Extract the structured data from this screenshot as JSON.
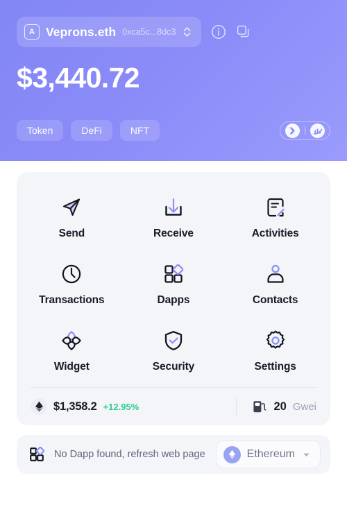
{
  "header": {
    "avatar_letter": "A",
    "account_name": "Veprons.eth",
    "account_address": "0xca5c...8dc3",
    "balance": "$3,440.72",
    "tabs": [
      {
        "label": "Token"
      },
      {
        "label": "DeFi"
      },
      {
        "label": "NFT"
      }
    ],
    "brand_icons": [
      "bitkeep-logo-icon",
      "market-chart-logo-icon"
    ],
    "icons": {
      "avatar": "avatar-letter-icon",
      "switch_account": "chevron-up-down-icon",
      "info": "info-circle-icon",
      "copy": "copy-icon"
    },
    "colors": {
      "gradient_start": "#8286f5",
      "gradient_end": "#9a9bfc",
      "text": "#ffffff"
    }
  },
  "menu": {
    "items": [
      {
        "label": "Send",
        "icon": "send-paper-plane-icon"
      },
      {
        "label": "Receive",
        "icon": "receive-download-icon"
      },
      {
        "label": "Activities",
        "icon": "activities-document-edit-icon"
      },
      {
        "label": "Transactions",
        "icon": "transactions-clock-icon"
      },
      {
        "label": "Dapps",
        "icon": "dapps-grid-icon"
      },
      {
        "label": "Contacts",
        "icon": "contacts-person-icon"
      },
      {
        "label": "Widget",
        "icon": "widget-clover-icon"
      },
      {
        "label": "Security",
        "icon": "security-shield-check-icon"
      },
      {
        "label": "Settings",
        "icon": "settings-gear-icon"
      }
    ]
  },
  "stats": {
    "eth_icon": "ethereum-diamond-icon",
    "eth_price": "$1,358.2",
    "eth_change": "+12.95%",
    "change_color": "#2ecc8f",
    "gas_icon": "gas-pump-icon",
    "gas_value": "20",
    "gas_unit": "Gwei"
  },
  "footer": {
    "dapp_icon": "dapps-grid-icon",
    "dapp_message": "No Dapp found, refresh web page",
    "network": {
      "icon": "ethereum-circle-icon",
      "name": "Ethereum",
      "chevron": "chevron-down-icon"
    }
  }
}
